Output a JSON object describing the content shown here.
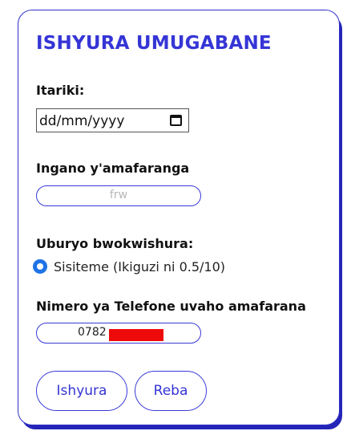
{
  "form": {
    "title": "ISHYURA UMUGABANE",
    "date_label": "Itariki:",
    "date_placeholder": "dd/mm/yyyy",
    "amount_label": "Ingano y'amafaranga",
    "amount_placeholder": "frw",
    "payment_method_label": "Uburyo bwokwishura:",
    "payment_option": {
      "label": "Sisiteme (Ikiguzi ni 0.5/10)",
      "selected": true
    },
    "phone_label": "Nimero ya Telefone uvaho amafarana",
    "phone_value_visible": "0782",
    "pay_button": "Ishyura",
    "view_button": "Reba"
  },
  "colors": {
    "accent": "#3535d6",
    "radio": "#1e73e6",
    "redaction": "#ee0a0a"
  },
  "icons": {
    "date_picker": "calendar-icon"
  }
}
